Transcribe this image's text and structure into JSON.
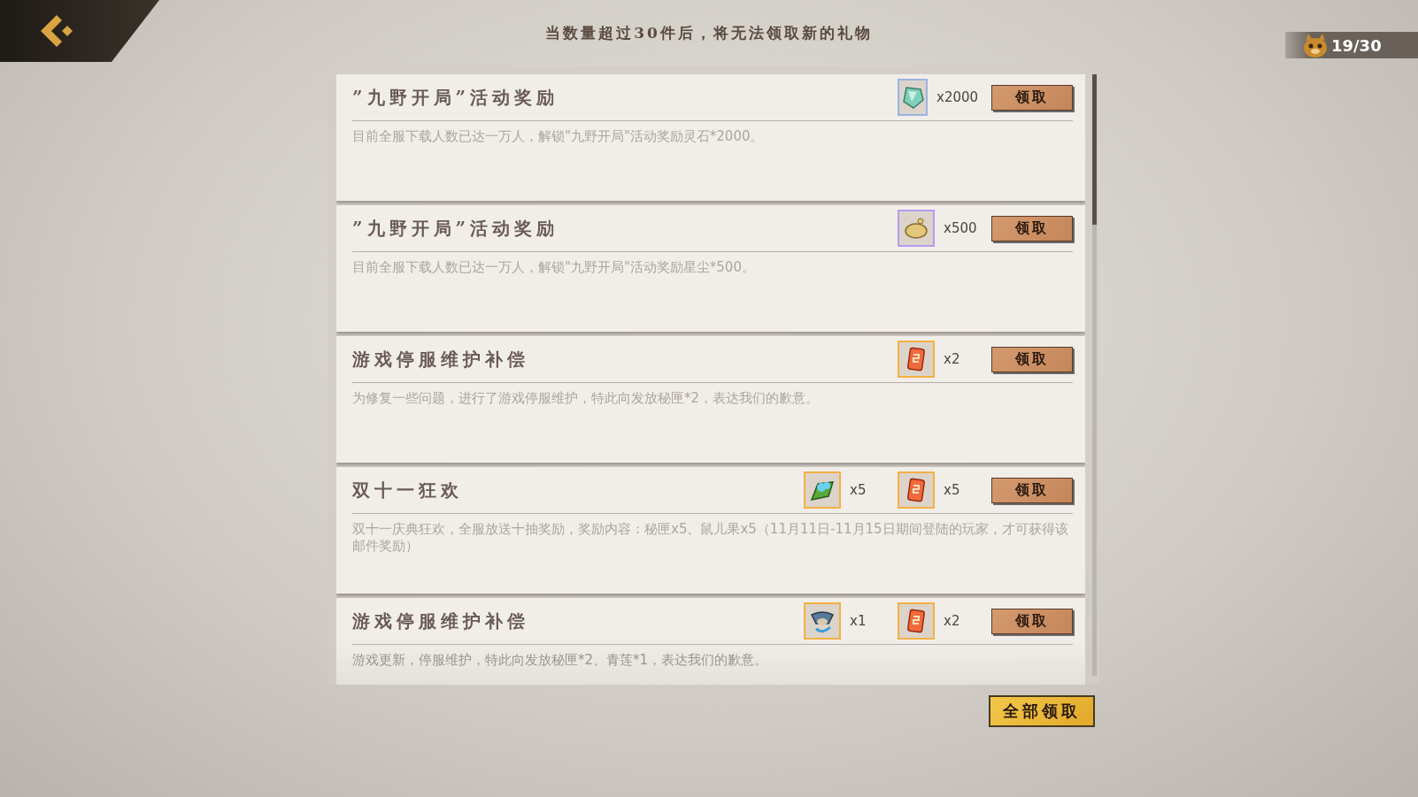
{
  "header": {
    "notice": "当数量超过30件后，将无法领取新的礼物",
    "counter": "19/30"
  },
  "mails": [
    {
      "title": "”九野开局”活动奖励",
      "rewards": [
        {
          "kind": "gem",
          "color": "#9ab4e0",
          "count": "x2000"
        }
      ],
      "claim": "领取",
      "description": "目前全服下载人数已达一万人，解锁\"九野开局\"活动奖励灵石*2000。"
    },
    {
      "title": "”九野开局”活动奖励",
      "rewards": [
        {
          "kind": "dust",
          "color": "#b49cf0",
          "count": "x500"
        }
      ],
      "claim": "领取",
      "description": "目前全服下载人数已达一万人，解锁\"九野开局\"活动奖励星尘*500。"
    },
    {
      "title": "游戏停服维护补偿",
      "rewards": [
        {
          "kind": "box",
          "color": "#f5b042",
          "count": "x2"
        }
      ],
      "claim": "领取",
      "description": "为修复一些问题，进行了游戏停服维护，特此向发放秘匣*2，表达我们的歉意。"
    },
    {
      "title": "双十一狂欢",
      "rewards": [
        {
          "kind": "leaf",
          "color": "#f5b042",
          "count": "x5"
        },
        {
          "kind": "box",
          "color": "#f5b042",
          "count": "x5"
        }
      ],
      "claim": "领取",
      "description": "双十一庆典狂欢，全服放送十抽奖励，奖励内容：秘匣x5、鼠儿果x5（11月11日-11月15日期间登陆的玩家，才可获得该邮件奖励）"
    },
    {
      "title": "游戏停服维护补偿",
      "rewards": [
        {
          "kind": "creature",
          "color": "#f5b042",
          "count": "x1"
        },
        {
          "kind": "box",
          "color": "#f5b042",
          "count": "x2"
        }
      ],
      "claim": "领取",
      "description": "游戏更新，停服维护，特此向发放秘匣*2、青莲*1，表达我们的歉意。"
    }
  ],
  "claim_all": "全部领取"
}
